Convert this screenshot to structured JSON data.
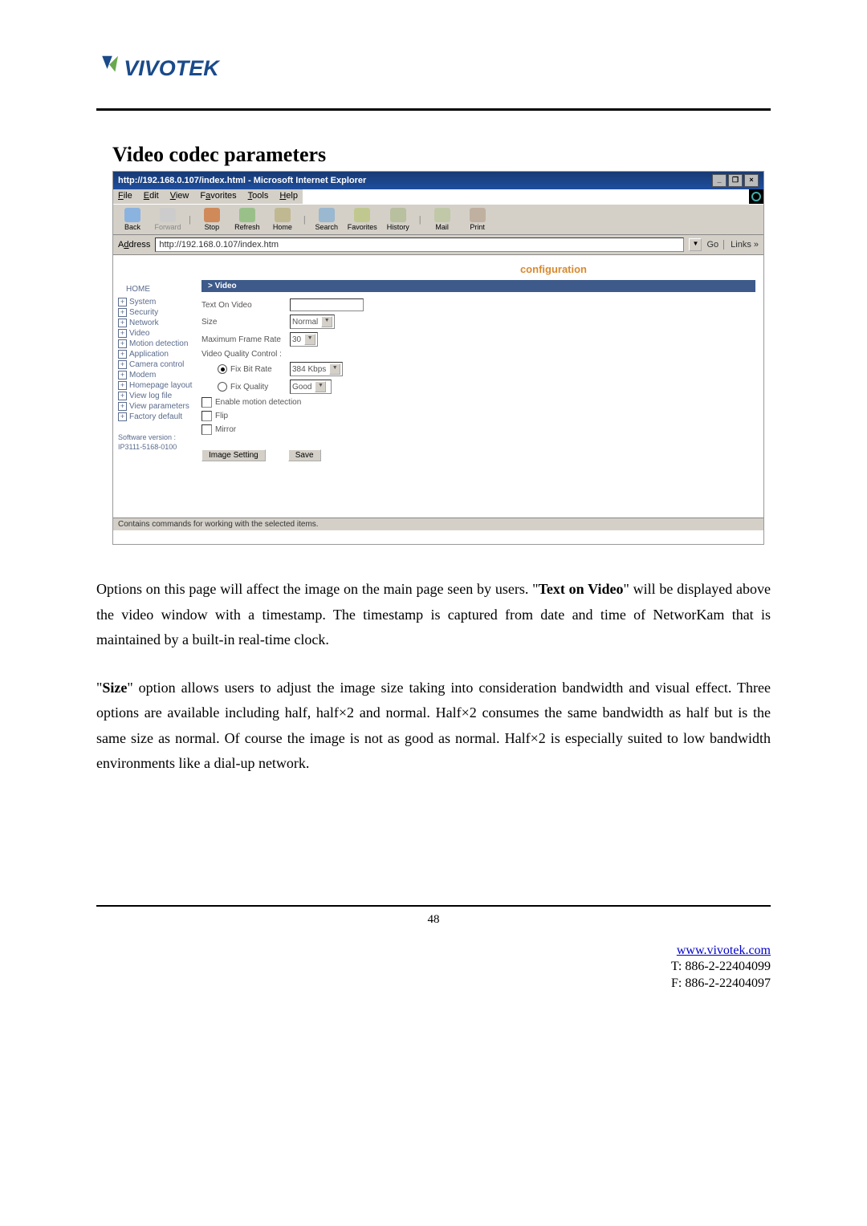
{
  "logo_text": "VIVOTEK",
  "section_title": "Video codec parameters",
  "browser": {
    "title": "http://192.168.0.107/index.html - Microsoft Internet Explorer",
    "menu": [
      "File",
      "Edit",
      "View",
      "Favorites",
      "Tools",
      "Help"
    ],
    "toolbar": {
      "back": "Back",
      "forward": "Forward",
      "stop": "Stop",
      "refresh": "Refresh",
      "home": "Home",
      "search": "Search",
      "favorites": "Favorites",
      "history": "History",
      "mail": "Mail",
      "print": "Print"
    },
    "address_label": "Address",
    "address_url": "http://192.168.0.107/index.htm",
    "go": "Go",
    "links": "Links »",
    "status": "Contains commands for working with the selected items."
  },
  "config": {
    "banner": "configuration",
    "home": "HOME",
    "sidebar": [
      "System",
      "Security",
      "Network",
      "Video",
      "Motion detection",
      "Application",
      "Camera control",
      "Modem",
      "Homepage layout",
      "View log file",
      "View parameters",
      "Factory default"
    ],
    "sw_ver_label": "Software version :",
    "sw_ver_value": "IP3111-5168-0100",
    "panel_head": "> Video",
    "text_on_video_label": "Text On Video",
    "size_label": "Size",
    "size_value": "Normal",
    "max_frame_label": "Maximum Frame Rate",
    "max_frame_value": "30",
    "vqc_label": "Video Quality Control :",
    "fix_bit_label": "Fix Bit Rate",
    "fix_bit_value": "384 Kbps",
    "fix_quality_label": "Fix Quality",
    "fix_quality_value": "Good",
    "enable_motion": "Enable motion detection",
    "flip": "Flip",
    "mirror": "Mirror",
    "image_setting_btn": "Image Setting",
    "save_btn": "Save"
  },
  "para1_a": "Options on this page will affect the image on the main page seen by users. \"",
  "para1_b": "Text on Video",
  "para1_c": "\" will be displayed above the video window with a timestamp. The timestamp is captured from date and time of NetworKam that is maintained by a built-in real-time clock.",
  "para2_a": "\"",
  "para2_b": "Size",
  "para2_c": "\" option allows users to adjust the image size taking into consideration bandwidth and visual effect. Three options are available including half, half×2 and normal. Half×2 consumes the same bandwidth as half but is the same size as normal. Of course the image is not as good as normal. Half×2 is especially suited to low bandwidth environments like a dial-up network.",
  "page_num": "48",
  "footer": {
    "url": "www.vivotek.com",
    "tel": "T: 886-2-22404099",
    "fax": "F: 886-2-22404097"
  }
}
